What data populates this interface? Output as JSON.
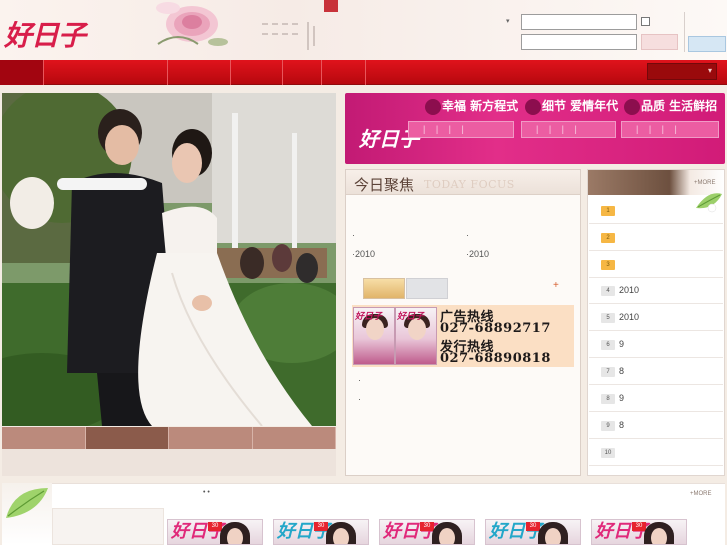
{
  "header": {
    "logo_text": "好日子",
    "login_arrow": "▾"
  },
  "nav": {
    "items": [
      "",
      "",
      "",
      "",
      "",
      "",
      ""
    ],
    "select_arrow": "▾"
  },
  "banner": {
    "logo_text": "好日子",
    "sections": [
      {
        "heading": "幸福 新方程式"
      },
      {
        "heading": "细节 爱情年代"
      },
      {
        "heading": "品质 生活鲜招"
      }
    ],
    "field_ticks": "| | | |"
  },
  "focus": {
    "title_cn": "今日聚焦",
    "title_en": "TODAY FOCUS",
    "year_a": "2010",
    "year_b": "2010",
    "bullet": "·",
    "plus": "+",
    "ad": {
      "cover_logo": "好日子",
      "label_1": "广告热线",
      "number_1": "027-68892717",
      "label_2": "发行热线",
      "number_2": "027-68890818"
    }
  },
  "ranking": {
    "more_label": "+MORE",
    "rows": [
      {
        "num": "1",
        "text": ""
      },
      {
        "num": "2",
        "text": ""
      },
      {
        "num": "3",
        "text": ""
      },
      {
        "num": "4",
        "text": "2010"
      },
      {
        "num": "5",
        "text": "2010"
      },
      {
        "num": "6",
        "text": "9"
      },
      {
        "num": "7",
        "text": "8"
      },
      {
        "num": "8",
        "text": "9"
      },
      {
        "num": "9",
        "text": "8"
      },
      {
        "num": "10",
        "text": ""
      }
    ]
  },
  "bottom": {
    "dots": "• •",
    "more_label": "+MORE",
    "magazines": [
      {
        "logo": "好日子",
        "badge": "30"
      },
      {
        "logo": "好日子",
        "badge": "30"
      },
      {
        "logo": "好日子",
        "badge": "30"
      },
      {
        "logo": "好日子",
        "badge": "30"
      },
      {
        "logo": "好日子",
        "badge": "30"
      }
    ]
  },
  "colors": {
    "brand_red": "#d81e4a",
    "nav_red": "#c90c14",
    "banner_magenta": "#d91f7e",
    "rank_highlight": "#f6b744"
  }
}
